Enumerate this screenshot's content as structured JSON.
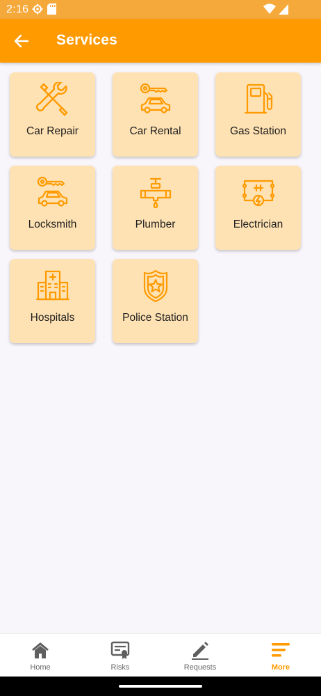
{
  "status_bar": {
    "time": "2:16"
  },
  "app_bar": {
    "title": "Services"
  },
  "colors": {
    "accent": "#ff9a00",
    "tile_bg": "#ffe2b3",
    "icon": "#ff9a00"
  },
  "services": [
    {
      "label": "Car Repair",
      "icon": "wrench-screwdriver-icon"
    },
    {
      "label": "Car Rental",
      "icon": "car-key-icon"
    },
    {
      "label": "Gas Station",
      "icon": "fuel-pump-icon"
    },
    {
      "label": "Locksmith",
      "icon": "car-key-icon"
    },
    {
      "label": "Plumber",
      "icon": "faucet-icon"
    },
    {
      "label": "Electrician",
      "icon": "electrical-circuit-icon"
    },
    {
      "label": "Hospitals",
      "icon": "hospital-building-icon"
    },
    {
      "label": "Police Station",
      "icon": "police-badge-icon"
    }
  ],
  "bottom_nav": [
    {
      "label": "Home",
      "icon": "home-icon",
      "active": false
    },
    {
      "label": "Risks",
      "icon": "certificate-icon",
      "active": false
    },
    {
      "label": "Requests",
      "icon": "pencil-icon",
      "active": false
    },
    {
      "label": "More",
      "icon": "menu-lines-icon",
      "active": true
    }
  ]
}
